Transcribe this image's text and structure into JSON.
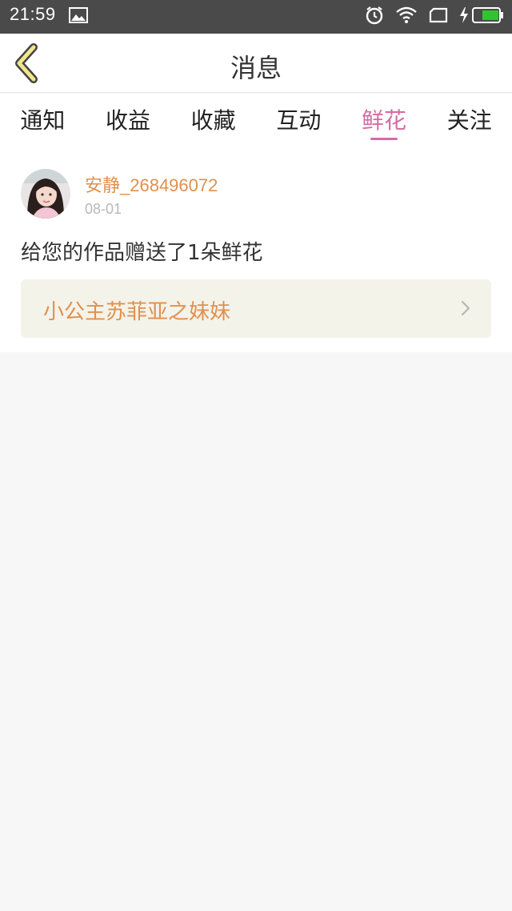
{
  "status": {
    "time": "21:59",
    "icons": [
      "gallery-icon",
      "alarm-icon",
      "wifi-icon",
      "sim-icon",
      "charging-icon",
      "battery-icon"
    ],
    "battery_color": "#2ec52e"
  },
  "nav": {
    "title": "消息",
    "back_icon": "chevron-left-icon",
    "back_color": "#f0e68c"
  },
  "tabs": [
    {
      "label": "通知"
    },
    {
      "label": "收益"
    },
    {
      "label": "收藏"
    },
    {
      "label": "互动"
    },
    {
      "label": "鲜花",
      "active": true
    },
    {
      "label": "关注"
    }
  ],
  "notification": {
    "username": "安静_268496072",
    "date": "08-01",
    "message": "给您的作品赠送了1朵鲜花",
    "work_title": "小公主苏菲亚之妹妹"
  },
  "colors": {
    "accent": "#d66ba2",
    "highlight": "#e0904e",
    "card_bg": "#f4f3ea"
  }
}
